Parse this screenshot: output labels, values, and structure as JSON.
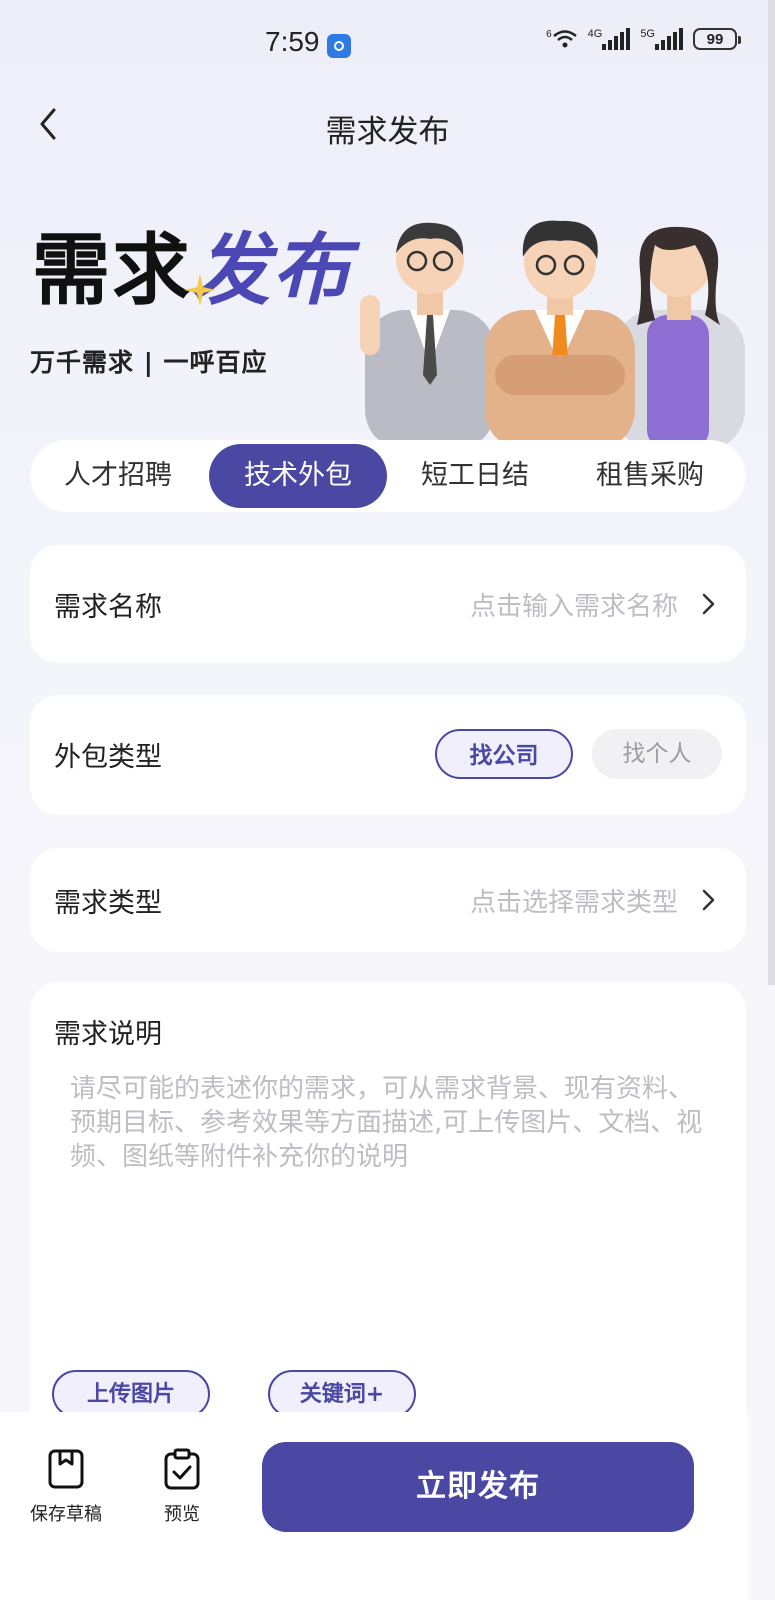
{
  "status_bar": {
    "time": "7:59",
    "wifi_label": "6",
    "signal1_label": "4G",
    "signal2_label": "5G",
    "battery": "99"
  },
  "header": {
    "title": "需求发布"
  },
  "banner": {
    "title_part1": "需求",
    "title_part2": "发布",
    "subtitle": "万千需求 | 一呼百应"
  },
  "tabs": [
    {
      "label": "人才招聘",
      "active": false
    },
    {
      "label": "技术外包",
      "active": true
    },
    {
      "label": "短工日结",
      "active": false
    },
    {
      "label": "租售采购",
      "active": false
    }
  ],
  "form": {
    "name": {
      "label": "需求名称",
      "placeholder": "点击输入需求名称"
    },
    "outsource_type": {
      "label": "外包类型",
      "options": [
        "找公司",
        "找个人"
      ],
      "selected": "找公司"
    },
    "demand_type": {
      "label": "需求类型",
      "placeholder": "点击选择需求类型"
    },
    "description": {
      "label": "需求说明",
      "placeholder": "请尽可能的表述你的需求，可从需求背景、现有资料、预期目标、参考效果等方面描述,可上传图片、文档、视频、图纸等附件补充你的说明",
      "upload_image_label": "上传图片",
      "keywords_label": "关键词+"
    }
  },
  "bottom_bar": {
    "save_draft_label": "保存草稿",
    "preview_label": "预览",
    "publish_label": "立即发布"
  },
  "colors": {
    "accent": "#4b48a3",
    "placeholder": "#bdbdc4"
  }
}
